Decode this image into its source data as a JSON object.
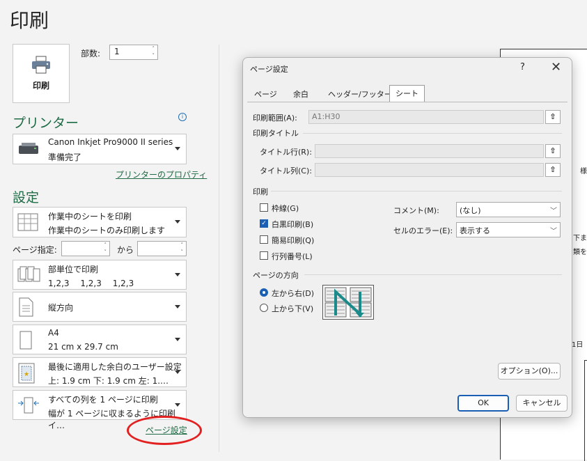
{
  "page": {
    "title": "印刷"
  },
  "print_button": {
    "label": "印刷"
  },
  "copies": {
    "label": "部数:",
    "value": "1"
  },
  "printer": {
    "heading": "プリンター",
    "name": "Canon Inkjet Pro9000 II series",
    "status": "準備完了",
    "properties_link": "プリンターのプロパティ"
  },
  "settings": {
    "heading": "設定",
    "what": {
      "line1": "作業中のシートを印刷",
      "line2": "作業中のシートのみ印刷します"
    },
    "pages": {
      "label": "ページ指定:",
      "to": "から",
      "from_value": "",
      "to_value": ""
    },
    "collate": {
      "line1": "部単位で印刷",
      "line2": "1,2,3　 1,2,3　 1,2,3"
    },
    "orientation": {
      "line1": "縦方向"
    },
    "paper": {
      "line1": "A4",
      "line2": "21 cm x 29.7 cm"
    },
    "margins": {
      "line1": "最後に適用した余白のユーザー設定",
      "line2": "上: 1.9 cm 下: 1.9 cm 左: 1.…"
    },
    "scaling": {
      "line1": "すべての列を 1 ページに印刷",
      "line2": "幅が 1 ページに収まるように印刷イ…"
    },
    "page_setup_link": "ページ設定"
  },
  "preview": {
    "chars": [
      "様",
      "下ま",
      "類を",
      "1日"
    ]
  },
  "dialog": {
    "title": "ページ設定",
    "help": "?",
    "close": "✕",
    "tabs": [
      "ページ",
      "余白",
      "ヘッダー/フッター",
      "シート"
    ],
    "print_area": {
      "label": "印刷範囲(A):",
      "value": "A1:H30"
    },
    "print_titles": {
      "heading": "印刷タイトル",
      "rows_label": "タイトル行(R):",
      "cols_label": "タイトル列(C):"
    },
    "print": {
      "heading": "印刷",
      "gridlines": "枠線(G)",
      "black_white": "白黒印刷(B)",
      "draft": "簡易印刷(Q)",
      "row_col_headings": "行列番号(L)",
      "comments_label": "コメント(M):",
      "comments_value": "(なし)",
      "errors_label": "セルのエラー(E):",
      "errors_value": "表示する"
    },
    "page_order": {
      "heading": "ページの方向",
      "down_then_over": "左から右(D)",
      "over_then_down": "上から下(V)"
    },
    "options_button": "オプション(O)...",
    "ok_button": "OK",
    "cancel_button": "キャンセル"
  },
  "colors": {
    "accent_green": "#1e6b45",
    "dialog_blue": "#1a5fb4",
    "annotation_red": "#e32020"
  }
}
